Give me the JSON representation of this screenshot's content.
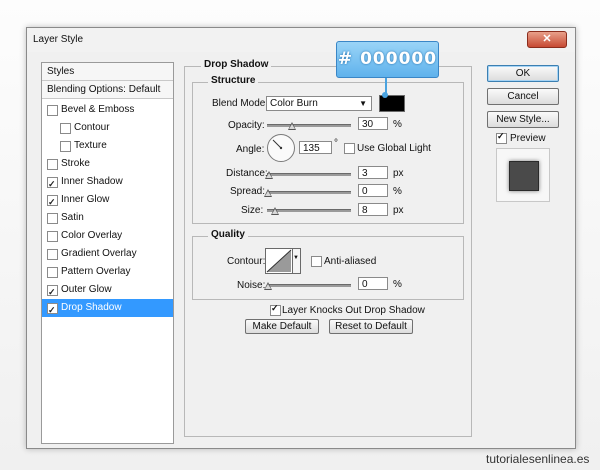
{
  "window": {
    "title": "Layer Style",
    "close_glyph": "✕"
  },
  "stylelist": {
    "header": "Styles",
    "blending": "Blending Options: Default",
    "items": [
      {
        "label": "Bevel & Emboss",
        "checked": false,
        "indent": false,
        "selected": false
      },
      {
        "label": "Contour",
        "checked": false,
        "indent": true,
        "selected": false
      },
      {
        "label": "Texture",
        "checked": false,
        "indent": true,
        "selected": false
      },
      {
        "label": "Stroke",
        "checked": false,
        "indent": false,
        "selected": false
      },
      {
        "label": "Inner Shadow",
        "checked": true,
        "indent": false,
        "selected": false
      },
      {
        "label": "Inner Glow",
        "checked": true,
        "indent": false,
        "selected": false
      },
      {
        "label": "Satin",
        "checked": false,
        "indent": false,
        "selected": false
      },
      {
        "label": "Color Overlay",
        "checked": false,
        "indent": false,
        "selected": false
      },
      {
        "label": "Gradient Overlay",
        "checked": false,
        "indent": false,
        "selected": false
      },
      {
        "label": "Pattern Overlay",
        "checked": false,
        "indent": false,
        "selected": false
      },
      {
        "label": "Outer Glow",
        "checked": true,
        "indent": false,
        "selected": false
      },
      {
        "label": "Drop Shadow",
        "checked": true,
        "indent": false,
        "selected": true
      }
    ]
  },
  "drop_shadow": {
    "title": "Drop Shadow",
    "structure": {
      "title": "Structure",
      "blend_mode_label": "Blend Mode:",
      "blend_mode_value": "Color Burn",
      "shadow_color": "#000000",
      "opacity_label": "Opacity:",
      "opacity_value": "30",
      "opacity_unit": "%",
      "angle_label": "Angle:",
      "angle_value": "135",
      "angle_unit": "°",
      "global_light_label": "Use Global Light",
      "global_light_checked": false,
      "distance_label": "Distance:",
      "distance_value": "3",
      "distance_unit": "px",
      "spread_label": "Spread:",
      "spread_value": "0",
      "spread_unit": "%",
      "size_label": "Size:",
      "size_value": "8",
      "size_unit": "px"
    },
    "quality": {
      "title": "Quality",
      "contour_label": "Contour:",
      "anti_aliased_label": "Anti-aliased",
      "anti_aliased_checked": false,
      "noise_label": "Noise:",
      "noise_value": "0",
      "noise_unit": "%"
    },
    "knockout_label": "Layer Knocks Out Drop Shadow",
    "knockout_checked": true,
    "make_default": "Make Default",
    "reset_default": "Reset to Default"
  },
  "buttons": {
    "ok": "OK",
    "cancel": "Cancel",
    "new_style": "New Style...",
    "preview_label": "Preview",
    "preview_checked": true
  },
  "callout": "# 000000",
  "footer": "tutorialesenlinea.es",
  "colors": {
    "selection": "#3399ff",
    "callout": "#5fb2ec"
  }
}
